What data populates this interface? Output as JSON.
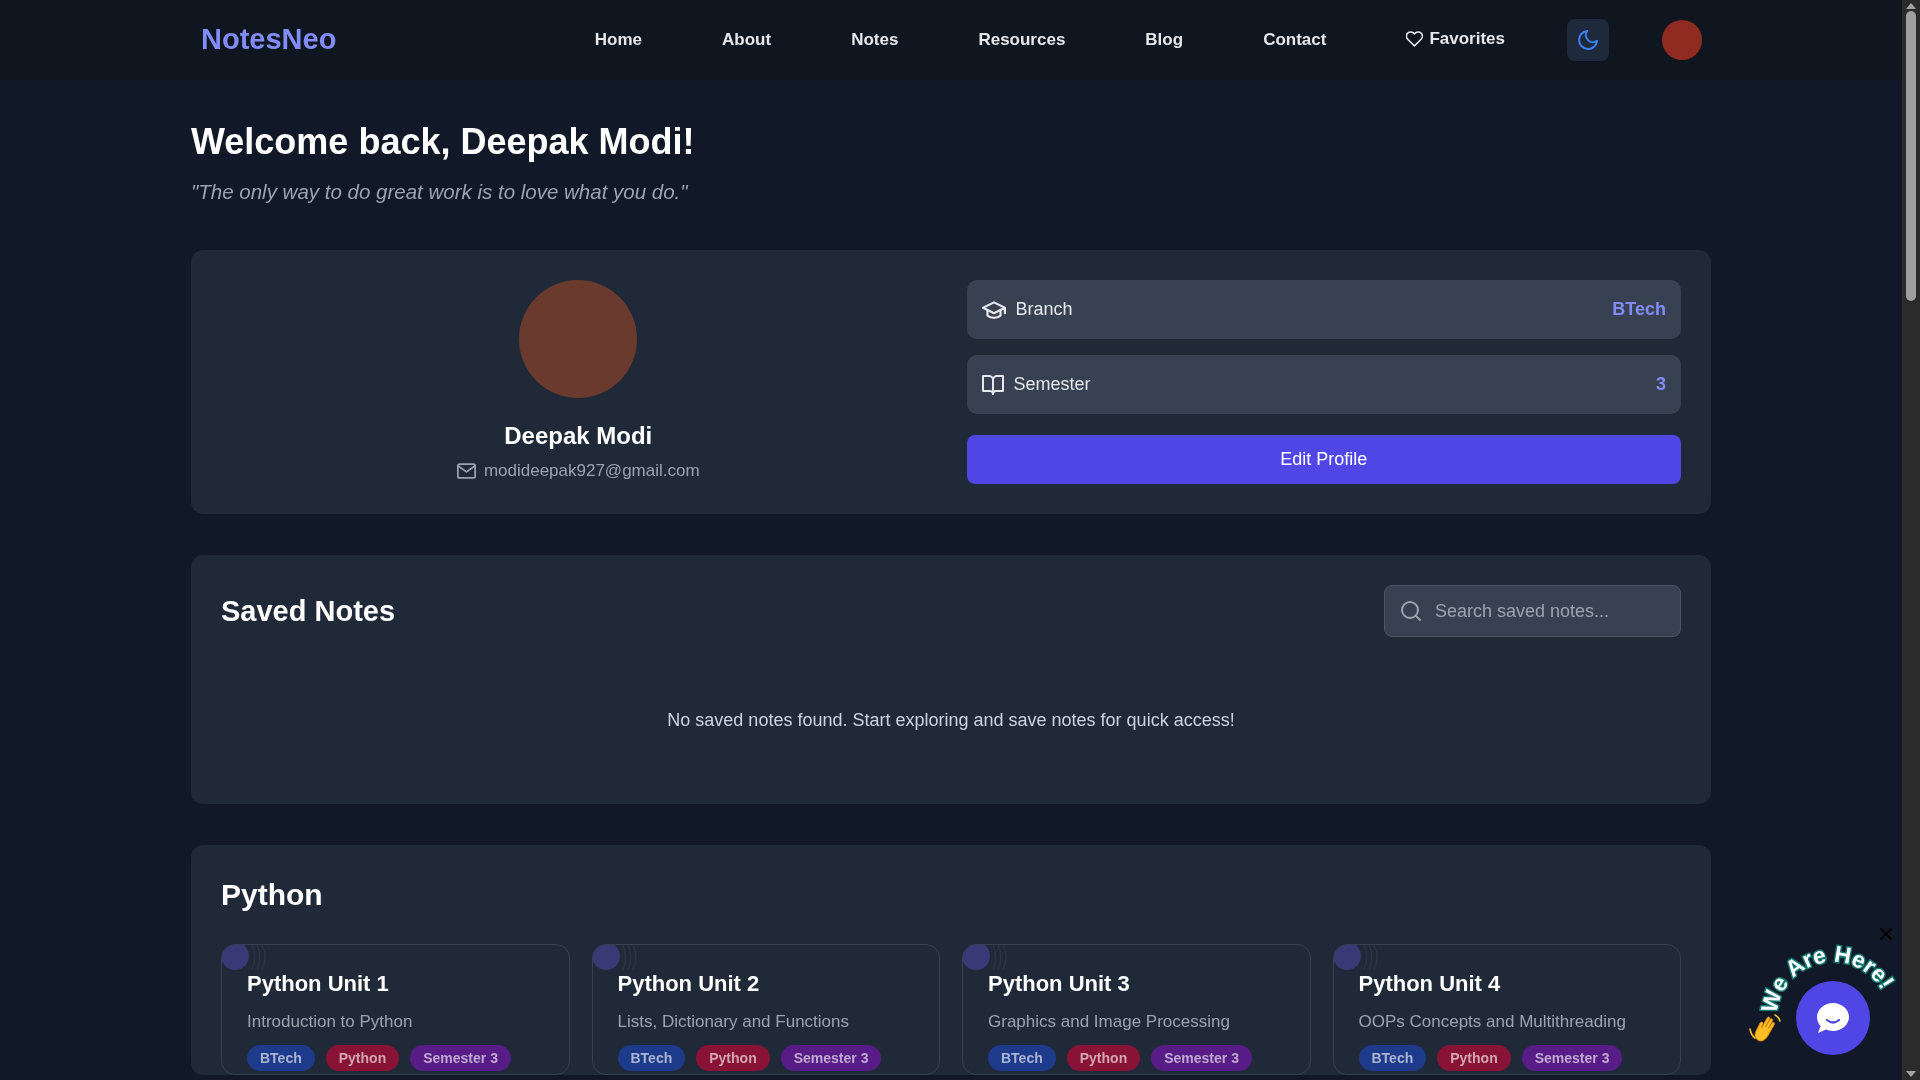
{
  "navbar": {
    "brand": "NotesNeo",
    "links": [
      {
        "label": "Home",
        "kind": "text"
      },
      {
        "label": "About",
        "kind": "text"
      },
      {
        "label": "Notes",
        "kind": "text"
      },
      {
        "label": "Resources",
        "kind": "text"
      },
      {
        "label": "Blog",
        "kind": "text"
      },
      {
        "label": "Contact",
        "kind": "text"
      },
      {
        "label": "Favorites",
        "kind": "favorite"
      }
    ]
  },
  "greeting": {
    "title": "Welcome back, Deepak Modi!",
    "quote": "\"The only way to do great work is to love what you do.\""
  },
  "profile": {
    "name": "Deepak Modi",
    "email": "modideepak927@gmail.com",
    "details": [
      {
        "kind": "branch",
        "label": "Branch",
        "value": "BTech"
      },
      {
        "kind": "semester",
        "label": "Semester",
        "value": "3"
      }
    ],
    "button": "Edit Profile"
  },
  "saved_notes": {
    "title": "Saved Notes",
    "search": {
      "placeholder": "Search saved notes..."
    },
    "empty_message": "No saved notes found. Start exploring and save notes for quick access!"
  },
  "sections": [
    {
      "title": "Python",
      "notes": [
        {
          "title": "Python Unit 1",
          "description": "Introduction to Python",
          "tags": [
            {
              "label": "BTech",
              "color": "#1e3a8a"
            },
            {
              "label": "Python",
              "color": "#881337"
            },
            {
              "label": "Semester 3",
              "color": "#581c87"
            }
          ]
        },
        {
          "title": "Python Unit 2",
          "description": "Lists, Dictionary and Functions",
          "tags": [
            {
              "label": "BTech",
              "color": "#1e3a8a"
            },
            {
              "label": "Python",
              "color": "#881337"
            },
            {
              "label": "Semester 3",
              "color": "#581c87"
            }
          ]
        },
        {
          "title": "Python Unit 3",
          "description": "Graphics and Image Processing",
          "tags": [
            {
              "label": "BTech",
              "color": "#1e3a8a"
            },
            {
              "label": "Python",
              "color": "#881337"
            },
            {
              "label": "Semester 3",
              "color": "#581c87"
            }
          ]
        },
        {
          "title": "Python Unit 4",
          "description": "OOPs Concepts and Multithreading",
          "tags": [
            {
              "label": "BTech",
              "color": "#1e3a8a"
            },
            {
              "label": "Python",
              "color": "#881337"
            },
            {
              "label": "Semester 3",
              "color": "#581c87"
            }
          ]
        }
      ]
    }
  ],
  "chat_widget": {
    "label": "We Are Here!"
  }
}
